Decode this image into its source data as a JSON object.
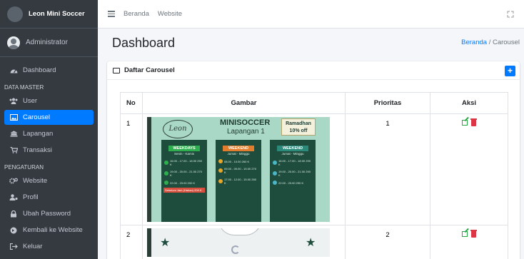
{
  "sidebar": {
    "brand": "Leon Mini Soccer",
    "user": "Administrator",
    "items": [
      {
        "label": "Dashboard",
        "icon": "tachometer-icon"
      },
      {
        "label": "User",
        "icon": "users-icon"
      },
      {
        "label": "Carousel",
        "icon": "image-icon",
        "active": true
      },
      {
        "label": "Lapangan",
        "icon": "landmark-icon"
      },
      {
        "label": "Transaksi",
        "icon": "cart-icon"
      },
      {
        "label": "Website",
        "icon": "gears-icon"
      },
      {
        "label": "Profil",
        "icon": "user-cog-icon"
      },
      {
        "label": "Ubah Password",
        "icon": "lock-icon"
      },
      {
        "label": "Kembali ke Website",
        "icon": "globe-icon"
      },
      {
        "label": "Keluar",
        "icon": "logout-icon"
      }
    ],
    "headers": {
      "data_master": "DATA MASTER",
      "pengaturan": "PENGATURAN"
    }
  },
  "topbar": {
    "links": [
      "Beranda",
      "Website"
    ]
  },
  "page": {
    "title": "Dashboard",
    "breadcrumb": {
      "home": "Beranda",
      "separator": "/",
      "current": "Carousel"
    }
  },
  "card": {
    "title": "Daftar Carousel",
    "add_label": "+"
  },
  "table": {
    "headers": [
      "No",
      "Gambar",
      "Prioritas",
      "Aksi"
    ],
    "rows": [
      {
        "no": "1",
        "prioritas": "1"
      },
      {
        "no": "2",
        "prioritas": "2"
      }
    ]
  },
  "carousel1": {
    "logo": "Leon",
    "title": "MINISOCCER",
    "subtitle": "Lapangan 1",
    "promo_line1": "Ramadhan",
    "promo_line2": "10% off",
    "panels": [
      {
        "tag": "WEEKDAYS",
        "sub": "Senin - Kamis",
        "slots": [
          "16.00 - 17.00 - 18.00  250 K",
          "19.00 - 20.00 - 21.00  270 K",
          "22.00 - 23.00      200 K"
        ],
        "note": "Sebelum Jam (Harian) 200 K"
      },
      {
        "tag": "WEEKEND",
        "sub": "Jumat - Minggu",
        "slots": [
          "08.00 - 10.00      260 K",
          "09.00 - 09.00 - 15.00  270 K",
          "17.00 - 12.00 - 15.00  280 K"
        ]
      },
      {
        "tag": "WEEKEND",
        "sub": "Jumat - Minggu",
        "slots": [
          "16.00 - 17.00 - 18.00  290 K",
          "19.00 - 20.00 - 21.00  290 K",
          "22.00 - 23.00      290 K"
        ]
      }
    ]
  },
  "colors": {
    "sidebar_bg": "#343a40",
    "primary": "#007bff",
    "success": "#28a745",
    "danger": "#dc3545"
  }
}
